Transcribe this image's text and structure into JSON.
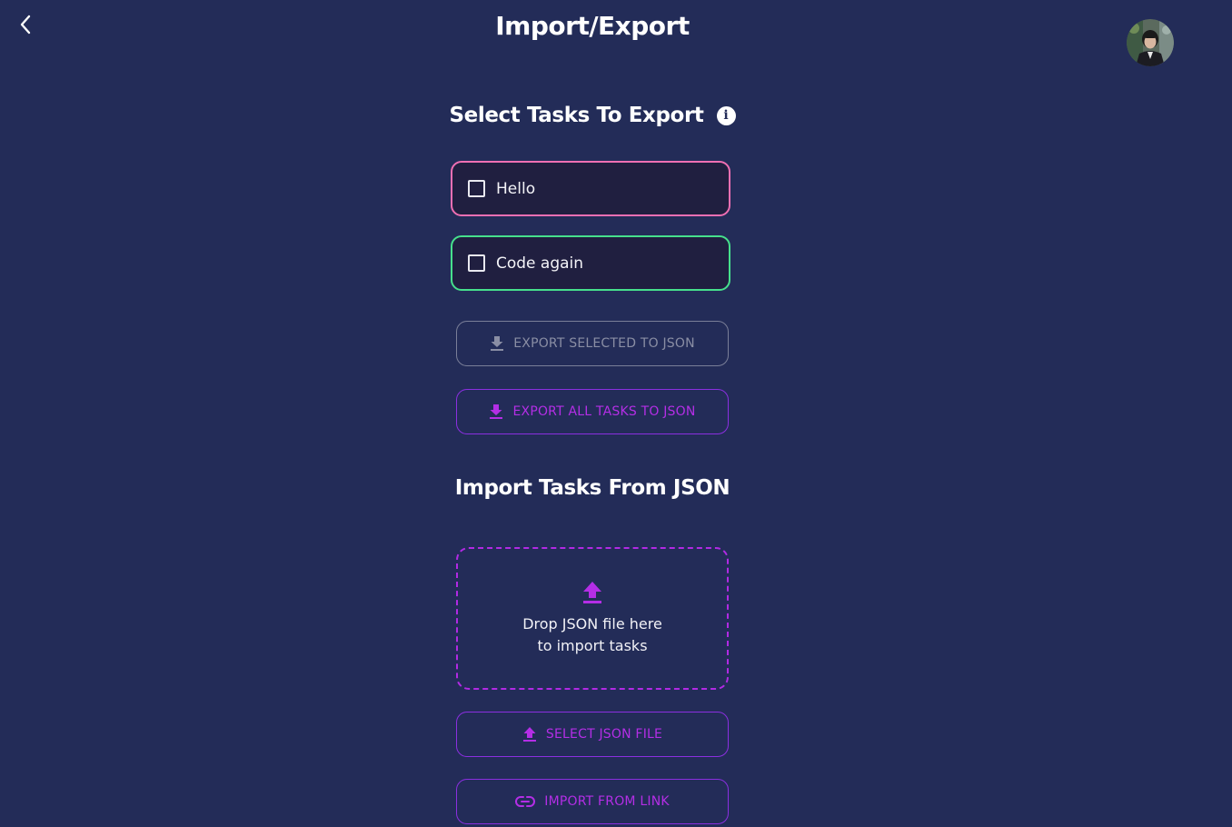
{
  "header": {
    "title": "Import/Export",
    "back_icon": "chevron-left-icon",
    "avatar_icon": "user-avatar"
  },
  "export_section": {
    "title": "Select Tasks To Export",
    "info_icon_glyph": "i",
    "tasks": [
      {
        "label": "Hello",
        "checked": false,
        "border_color": "#ef6fb3"
      },
      {
        "label": "Code again",
        "checked": false,
        "border_color": "#46e08c"
      }
    ],
    "export_selected_label": "EXPORT SELECTED TO JSON",
    "export_all_label": "EXPORT ALL TASKS TO JSON"
  },
  "import_section": {
    "title": "Import Tasks From JSON",
    "dropzone_line1": "Drop JSON file here",
    "dropzone_line2": "to import tasks",
    "select_file_label": "SELECT JSON FILE",
    "import_link_label": "IMPORT FROM LINK"
  },
  "colors": {
    "background": "#232c58",
    "accent": "#b42ee6",
    "disabled": "#8a8ea4",
    "card": "#201f40"
  }
}
